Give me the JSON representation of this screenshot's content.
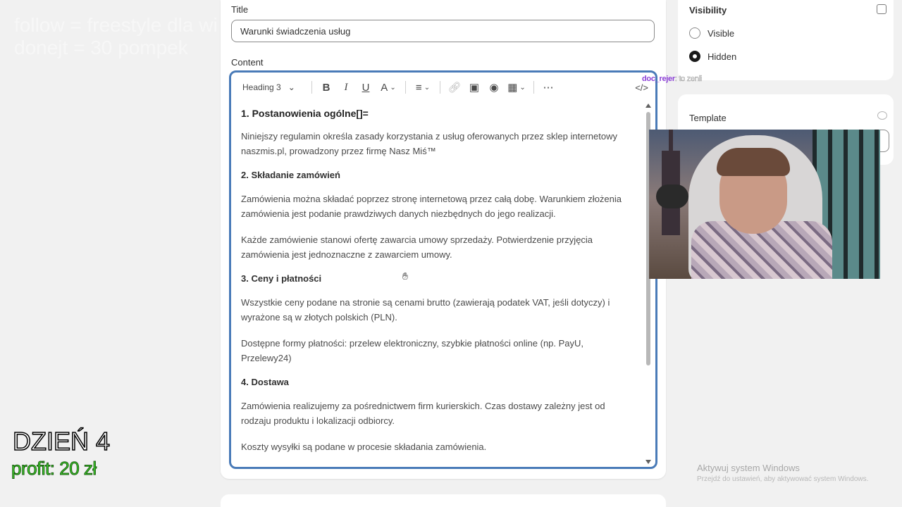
{
  "overlay": {
    "line1": "follow = freestyle dla wi",
    "line2": "donejt = 30 pompek",
    "day": "DZIEŃ 4",
    "profit": "profit: 20 zł"
  },
  "form": {
    "title_label": "Title",
    "title_value": "Warunki świadczenia usług",
    "content_label": "Content"
  },
  "toolbar": {
    "heading_select": "Heading 3",
    "icons": [
      "bold-icon",
      "italic-icon",
      "underline-icon",
      "text-color-icon",
      "align-icon",
      "link-icon",
      "image-icon",
      "video-icon",
      "table-icon",
      "more-icon",
      "code-view-icon"
    ]
  },
  "content": {
    "h1": "1. Postanowienia ogólne[]=",
    "p1": "Niniejszy regulamin określa zasady korzystania z usług oferowanych przez sklep internetowy naszmis.pl, prowadzony przez firmę Nasz Miś™",
    "h2": "2. Składanie zamówień",
    "p2": "Zamówienia można składać poprzez stronę internetową przez całą dobę. Warunkiem złożenia zamówienia jest podanie prawdziwych danych niezbędnych do jego realizacji.",
    "p3": "Każde zamówienie stanowi ofertę zawarcia umowy sprzedaży. Potwierdzenie przyjęcia zamówienia jest jednoznaczne z zawarciem umowy.",
    "h3": "3. Ceny i płatności",
    "p4": "Wszystkie ceny podane na stronie są cenami brutto (zawierają podatek VAT, jeśli dotyczy) i wyrażone są w złotych polskich (PLN).",
    "p5": "Dostępne formy płatności: przelew elektroniczny, szybkie płatności online (np. PayU, Przelewy24)",
    "h4": "4. Dostawa",
    "p6": "Zamówienia realizujemy za pośrednictwem firm kurierskich. Czas dostawy zależny jest od rodzaju produktu i lokalizacji odbiorcy.",
    "p7": "Koszty wysyłki są podane w procesie składania zamówienia."
  },
  "visibility": {
    "title": "Visibility",
    "options": [
      {
        "label": "Visible",
        "selected": false
      },
      {
        "label": "Hidden",
        "selected": true
      }
    ]
  },
  "template": {
    "label": "Template"
  },
  "chat": {
    "user": "doc_rejer",
    "message": ": to zenli"
  },
  "windows": {
    "title": "Aktywuj system Windows",
    "subtitle": "Przejdź do ustawień, aby aktywować system Windows."
  }
}
